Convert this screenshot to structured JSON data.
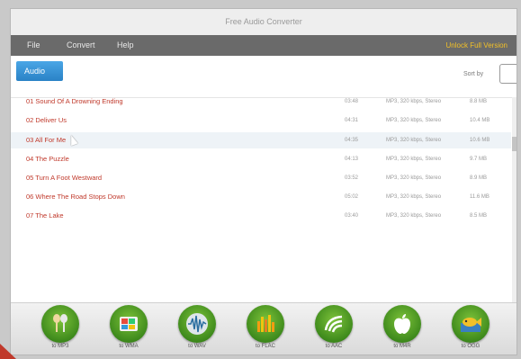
{
  "window": {
    "title": "Free Audio Converter"
  },
  "menu": {
    "items": [
      "File",
      "Convert",
      "Help"
    ],
    "right_text": "Unlock Full Version"
  },
  "toolbar": {
    "add_label": "Audio",
    "sort_label": "Sort by"
  },
  "files": [
    {
      "name": "01 Sound Of A Drowning Ending",
      "duration": "03:48",
      "format": "MP3, 320 kbps, Stereo",
      "size": "8.8 MB"
    },
    {
      "name": "02 Deliver Us",
      "duration": "04:31",
      "format": "MP3, 320 kbps, Stereo",
      "size": "10.4 MB"
    },
    {
      "name": "03 All For Me",
      "duration": "04:35",
      "format": "MP3, 320 kbps, Stereo",
      "size": "10.6 MB"
    },
    {
      "name": "04 The Puzzle",
      "duration": "04:13",
      "format": "MP3, 320 kbps, Stereo",
      "size": "9.7 MB"
    },
    {
      "name": "05 Turn A Foot Westward",
      "duration": "03:52",
      "format": "MP3, 320 kbps, Stereo",
      "size": "8.9 MB"
    },
    {
      "name": "06 Where The Road Stops Down",
      "duration": "05:02",
      "format": "MP3, 320 kbps, Stereo",
      "size": "11.6 MB"
    },
    {
      "name": "07 The Lake",
      "duration": "03:40",
      "format": "MP3, 320 kbps, Stereo",
      "size": "8.5 MB"
    }
  ],
  "converters": [
    {
      "label": "to MP3",
      "icon": "microphone-icon"
    },
    {
      "label": "to WMA",
      "icon": "windows-media-icon"
    },
    {
      "label": "to WAV",
      "icon": "waveform-icon"
    },
    {
      "label": "to FLAC",
      "icon": "equalizer-icon"
    },
    {
      "label": "to AAC",
      "icon": "aac-icon"
    },
    {
      "label": "to M4R",
      "icon": "apple-icon"
    },
    {
      "label": "to OGG",
      "icon": "ogg-fish-icon"
    }
  ],
  "colors": {
    "file_name": "#c0392b",
    "button_green": "#4f9e25",
    "add_button": "#2a82c6",
    "menubar": "#6a6a6a"
  }
}
